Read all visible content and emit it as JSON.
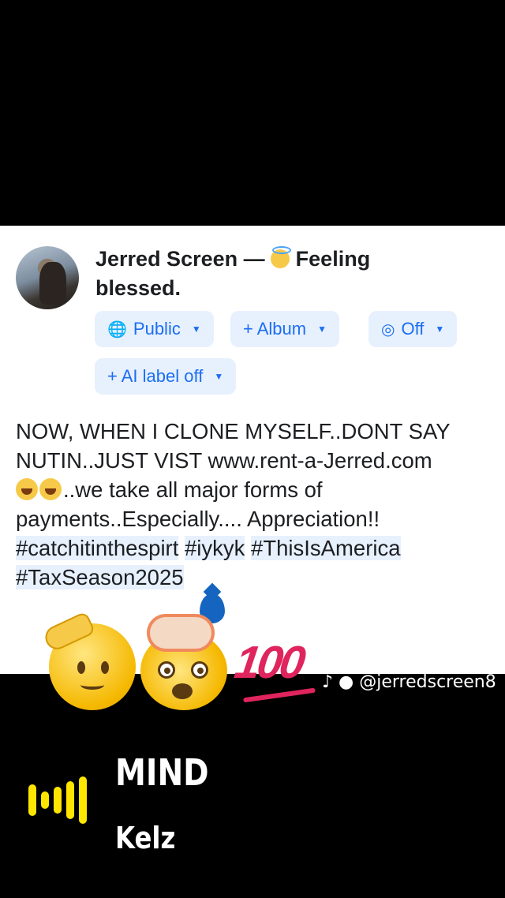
{
  "post": {
    "author": "Jerred Screen",
    "separator": "—",
    "feeling_emoji": "smiling-face-with-halo",
    "feeling": "Feeling blessed.",
    "chips": [
      {
        "icon": "globe-icon",
        "label": "Public"
      },
      {
        "icon": "plus-icon",
        "label": "+ Album"
      },
      {
        "icon": "instagram-icon",
        "label": "Off"
      },
      {
        "icon": "plus-icon",
        "label": "+ AI label off"
      }
    ],
    "text_line1": "NOW, WHEN I CLONE MYSELF..DONT SAY NUTIN..JUST VIST www.rent-a-Jerred.com",
    "text_line2": "..we take all major forms of payments..Especially.... Appreciation!!",
    "hashtags": [
      "#catchitinthespirt",
      "#iykyk",
      "#ThisIsAmerica",
      "#TaxSeason2025"
    ]
  },
  "overlay": {
    "stickers": [
      "saluting-face",
      "exploding-head",
      "hundred-points",
      "droplet"
    ],
    "hundred_text": "100",
    "tiktok_handle": "@jerredscreen8"
  },
  "music": {
    "title": "MIND",
    "artist": "Kelz",
    "accent_color": "#ffe600"
  },
  "colors": {
    "chip_bg": "#e7f0fd",
    "chip_text": "#1b6ef3",
    "hashtag_bg": "#e7f0fd"
  }
}
